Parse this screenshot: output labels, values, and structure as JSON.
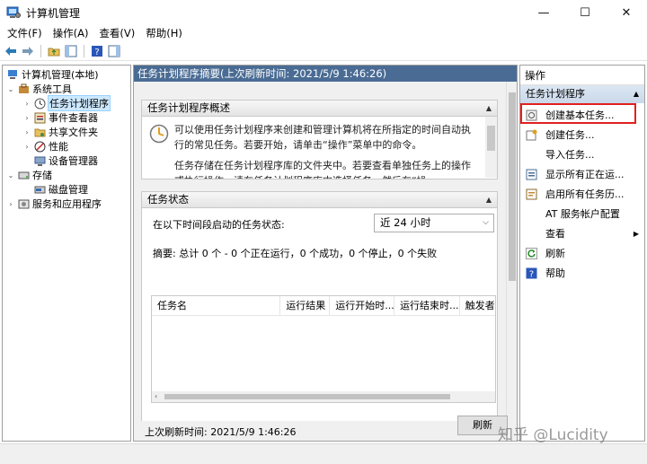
{
  "window": {
    "title": "计算机管理",
    "minimize": "—",
    "maximize": "☐",
    "close": "✕"
  },
  "menu": [
    "文件(F)",
    "操作(A)",
    "查看(V)",
    "帮助(H)"
  ],
  "tree": {
    "root": "计算机管理(本地)",
    "system_tools": "系统工具",
    "task_scheduler": "任务计划程序",
    "event_viewer": "事件查看器",
    "shared_folders": "共享文件夹",
    "performance": "性能",
    "device_manager": "设备管理器",
    "storage": "存储",
    "disk_management": "磁盘管理",
    "services_apps": "服务和应用程序"
  },
  "main": {
    "header": "任务计划程序摘要(上次刷新时间: 2021/5/9 1:46:26)",
    "overview": {
      "title": "任务计划程序概述",
      "line1": "可以使用任务计划程序来创建和管理计算机将在所指定的时间自动执行的常见任务。若要开始，请单击“操作”菜单中的命令。",
      "line2": "任务存储在任务计划程序库的文件夹中。若要查看单独任务上的操作或执行操作，请在任务计划程序库中选择任务，然后在“操"
    },
    "status": {
      "title": "任务状态",
      "label": "在以下时间段启动的任务状态:",
      "period": "近 24 小时",
      "summary": "摘要: 总计 0 个 - 0 个正在运行，0 个成功，0 个停止，0 个失败",
      "columns": [
        "任务名",
        "运行结果",
        "运行开始时...",
        "运行结束时...",
        "触发者"
      ]
    },
    "footer_text": "上次刷新时间: 2021/5/9 1:46:26",
    "refresh_label": "刷新"
  },
  "actions": {
    "header": "操作",
    "section": "任务计划程序",
    "items": [
      "创建基本任务...",
      "创建任务...",
      "导入任务...",
      "显示所有正在运...",
      "启用所有任务历...",
      "AT 服务帐户配置",
      "查看",
      "刷新",
      "帮助"
    ]
  },
  "watermark": "知乎 @Lucidity",
  "colors": {
    "header_blue": "#4a6c94",
    "highlight_red": "#e02020",
    "selection": "#cce8ff"
  }
}
